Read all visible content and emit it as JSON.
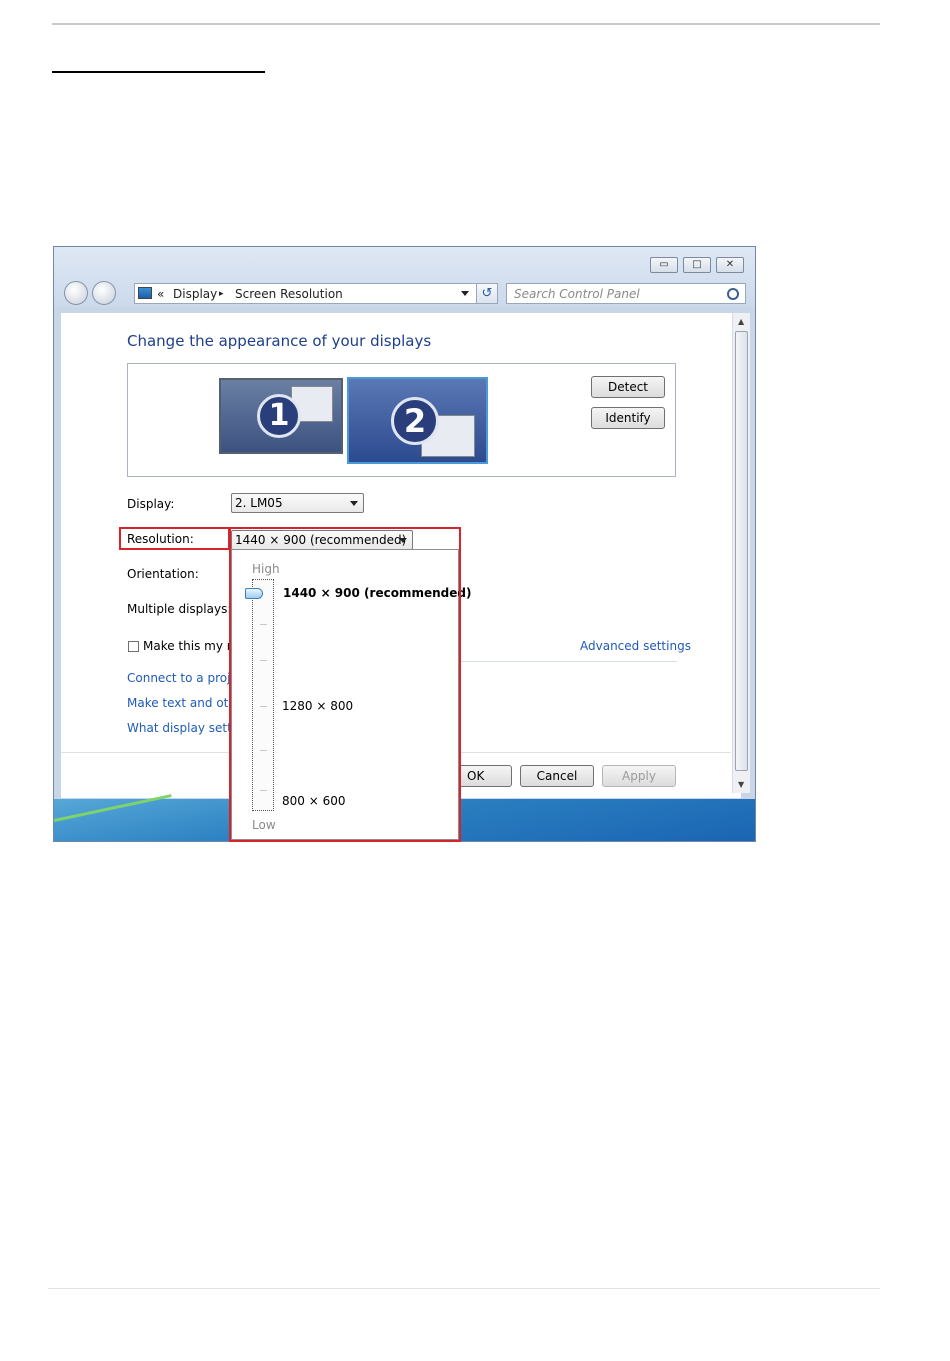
{
  "window": {
    "address": {
      "back_glyph": "«",
      "crumb1": "Display",
      "crumb_sep": "▸",
      "crumb2": "Screen Resolution",
      "refresh_glyph": "↺"
    },
    "search_placeholder": "Search Control Panel",
    "caption_buttons": {
      "minimize": "▭",
      "maximize": "□",
      "close": "✕"
    }
  },
  "main": {
    "heading": "Change the appearance of your displays",
    "monitors": [
      {
        "number": "1",
        "selected": false
      },
      {
        "number": "2",
        "selected": true
      }
    ],
    "detect_label": "Detect",
    "identify_label": "Identify",
    "display_label": "Display:",
    "display_value": "2. LM05",
    "resolution_label": "Resolution:",
    "resolution_value": "1440 × 900 (recommended)",
    "orientation_label": "Orientation:",
    "multiple_displays_label": "Multiple displays:",
    "main_display_checkbox_label": "Make this my m",
    "advanced_settings_link": "Advanced settings",
    "links": [
      "Connect to a projec",
      "Make text and othe",
      "What display settin"
    ],
    "ok_label": "OK",
    "cancel_label": "Cancel",
    "apply_label": "Apply"
  },
  "resolution_dropdown": {
    "high_label": "High",
    "low_label": "Low",
    "options": [
      "1440 × 900 (recommended)",
      "1280 × 800",
      "800 × 600"
    ],
    "selected_index": 0,
    "slider_level": 1.0
  },
  "colors": {
    "highlight_box": "#d6232c",
    "heading": "#1e3f8a",
    "link": "#1e5bb8"
  }
}
